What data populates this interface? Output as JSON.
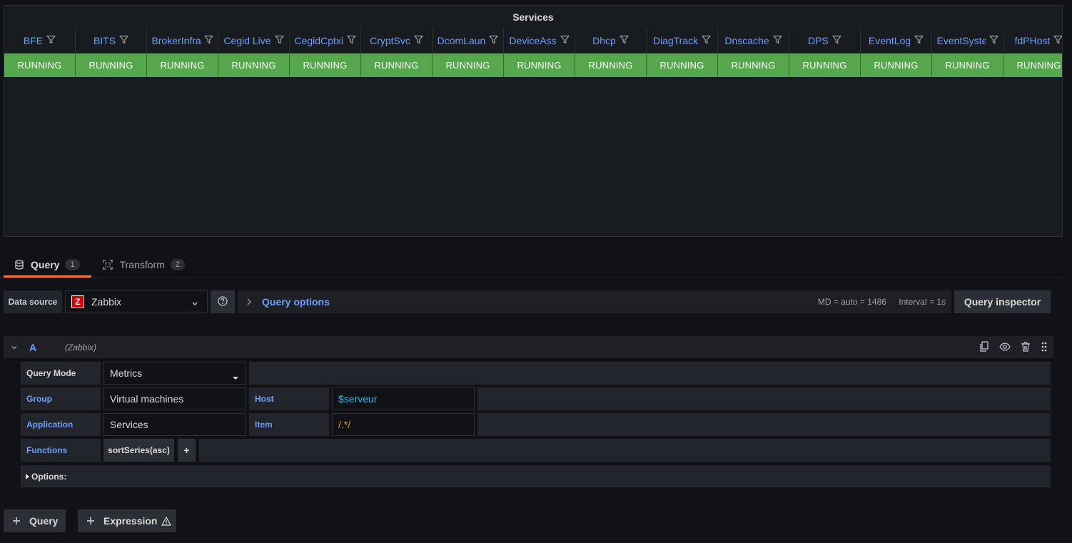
{
  "panel": {
    "title": "Services",
    "columns": [
      "BFE",
      "BITS",
      "BrokerInfra",
      "Cegid Live",
      "CegidCptxi",
      "CryptSvc",
      "DcomLaun",
      "DeviceAss",
      "Dhcp",
      "DiagTrack",
      "Dnscache",
      "DPS",
      "EventLog",
      "EventSyste",
      "fdPHost"
    ],
    "row": [
      "RUNNING",
      "RUNNING",
      "RUNNING",
      "RUNNING",
      "RUNNING",
      "RUNNING",
      "RUNNING",
      "RUNNING",
      "RUNNING",
      "RUNNING",
      "RUNNING",
      "RUNNING",
      "RUNNING",
      "RUNNING",
      "RUNNING"
    ],
    "status_color": "#56a64b",
    "header_color": "#6e9fff"
  },
  "tabs": [
    {
      "label": "Query",
      "count": "1",
      "icon": "database-icon"
    },
    {
      "label": "Transform",
      "count": "2",
      "icon": "transform-icon"
    }
  ],
  "datasource": {
    "label": "Data source",
    "selected": "Zabbix",
    "logo_letter": "Z",
    "query_options_label": "Query options",
    "max_data_points": "MD = auto = 1486",
    "interval": "Interval = 1s",
    "inspector_label": "Query inspector"
  },
  "query": {
    "ref_id": "A",
    "datasource_name": "(Zabbix)",
    "mode_label": "Query Mode",
    "mode_value": "Metrics",
    "group_label": "Group",
    "group_value": "Virtual machines",
    "host_label": "Host",
    "host_value": "$serveur",
    "application_label": "Application",
    "application_value": "Services",
    "item_label": "Item",
    "item_value": "/.*/",
    "functions_label": "Functions",
    "function_value": "sortSeries(asc)",
    "add_function": "+",
    "options_label": "Options:"
  },
  "buttons": {
    "add_query": "Query",
    "add_expression": "Expression"
  },
  "colors": {
    "accent": "#f47a35",
    "link": "#6e9fff"
  }
}
